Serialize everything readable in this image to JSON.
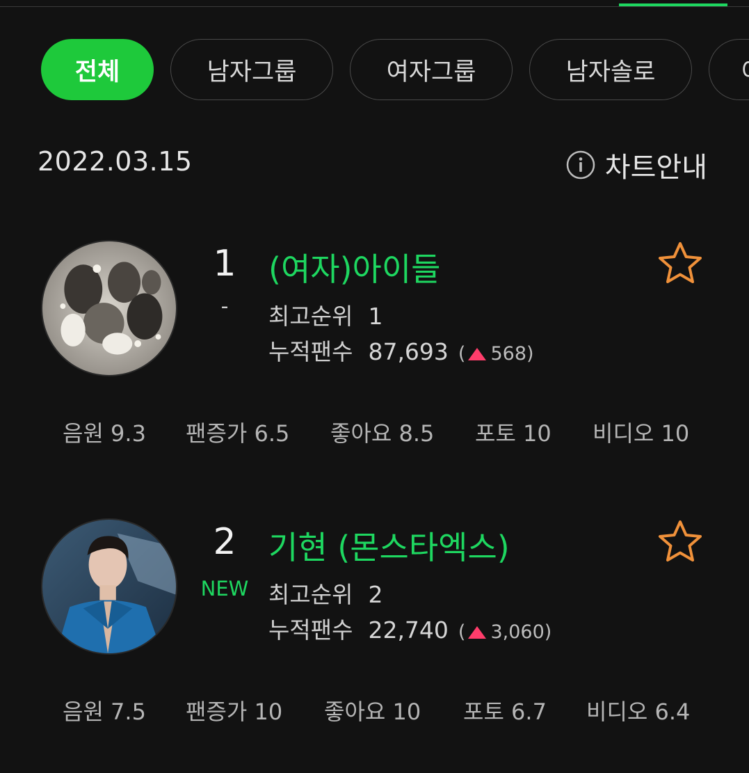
{
  "filters": [
    {
      "label": "전체",
      "active": true
    },
    {
      "label": "남자그룹",
      "active": false
    },
    {
      "label": "여자그룹",
      "active": false
    },
    {
      "label": "남자솔로",
      "active": false
    },
    {
      "label": "여",
      "active": false
    }
  ],
  "date": "2022.03.15",
  "chart_guide": {
    "label": "차트안내",
    "icon": "info-icon"
  },
  "accent_color": "#1ed760",
  "entries": [
    {
      "rank": "1",
      "change": "-",
      "name": "(여자)아이들",
      "best_rank_label": "최고순위",
      "best_rank": "1",
      "fans_label": "누적팬수",
      "fans": "87,693",
      "fans_delta_open": "(",
      "fans_delta": "568",
      "fans_delta_close": ")",
      "scores": [
        {
          "label": "음원 9.3"
        },
        {
          "label": "팬증가 6.5"
        },
        {
          "label": "좋아요 8.5"
        },
        {
          "label": "포토 10"
        },
        {
          "label": "비디오 10"
        }
      ]
    },
    {
      "rank": "2",
      "change": "NEW",
      "name": "기현 (몬스타엑스)",
      "best_rank_label": "최고순위",
      "best_rank": "2",
      "fans_label": "누적팬수",
      "fans": "22,740",
      "fans_delta_open": "(",
      "fans_delta": "3,060",
      "fans_delta_close": ")",
      "scores": [
        {
          "label": "음원 7.5"
        },
        {
          "label": "팬증가 10"
        },
        {
          "label": "좋아요 10"
        },
        {
          "label": "포토 6.7"
        },
        {
          "label": "비디오 6.4"
        }
      ]
    }
  ]
}
